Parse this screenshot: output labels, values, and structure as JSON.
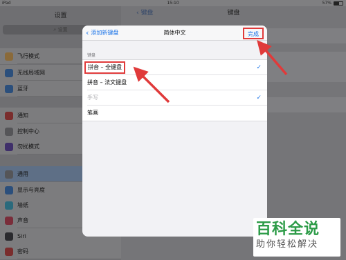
{
  "status_bar": {
    "device": "iPad",
    "time": "15:10",
    "battery_text": "57%",
    "battery_level": 0.57
  },
  "settings_panel": {
    "title": "设置",
    "search_placeholder": "设置",
    "items": [
      {
        "label": "飞行模式",
        "icon": "airplane-icon",
        "color": "#8a6a3a"
      },
      {
        "label": "无线局域网",
        "icon": "wifi-icon",
        "color": "#2b4f7c"
      },
      {
        "label": "蓝牙",
        "icon": "bluetooth-icon",
        "color": "#2b4f7c"
      },
      {
        "label": "通知",
        "icon": "notifications-icon",
        "color": "#7a2d2d"
      },
      {
        "label": "控制中心",
        "icon": "control-center-icon",
        "color": "#555558"
      },
      {
        "label": "勿扰模式",
        "icon": "moon-icon",
        "color": "#3f2f6a"
      },
      {
        "label": "通用",
        "icon": "gear-icon",
        "color": "#555558",
        "selected": true
      },
      {
        "label": "显示与亮度",
        "icon": "display-icon",
        "color": "#2b4f7c"
      },
      {
        "label": "墙纸",
        "icon": "wallpaper-icon",
        "color": "#2b6a7c"
      },
      {
        "label": "声音",
        "icon": "sound-icon",
        "color": "#7a2d3a"
      },
      {
        "label": "Siri",
        "icon": "siri-icon",
        "color": "#2a2a2e"
      },
      {
        "label": "密码",
        "icon": "lock-icon",
        "color": "#7a2d2d"
      }
    ]
  },
  "detail_panel": {
    "back_label": "键盘",
    "title": "键盘"
  },
  "modal": {
    "back_label": "添加新键盘",
    "title": "简体中文",
    "done_label": "完成",
    "section_header": "键盘",
    "keyboards": [
      {
        "label": "拼音 – 全键盘",
        "checked": true,
        "highlighted": true,
        "disabled": false
      },
      {
        "label": "拼音 – 法文键盘",
        "checked": false,
        "highlighted": false,
        "disabled": false
      },
      {
        "label": "手写",
        "checked": true,
        "highlighted": false,
        "disabled": true
      },
      {
        "label": "笔画",
        "checked": false,
        "highlighted": false,
        "disabled": false
      }
    ]
  },
  "watermark": {
    "main": "百科全说",
    "sub": "助你轻松解决"
  },
  "colors": {
    "accent": "#1a73e8",
    "highlight": "#e03a3a",
    "watermark_green": "#2c9b47"
  }
}
